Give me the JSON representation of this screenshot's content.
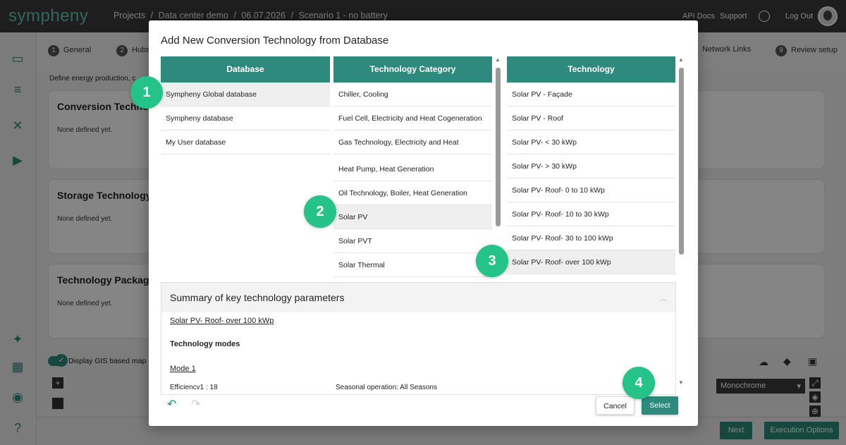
{
  "app": {
    "logo": "sympheny"
  },
  "breadcrumb": [
    "Projects",
    "/",
    "Data center demo",
    "/",
    "06.07.2026",
    "/",
    "Scenario 1 - no battery"
  ],
  "topnav": {
    "api_docs": "API Docs",
    "support": "Support",
    "logout": "Log Out"
  },
  "steps": [
    {
      "num": "1",
      "label": "General"
    },
    {
      "num": "2",
      "label": "Hubs"
    },
    {
      "num": "",
      "label": "Network Links"
    },
    {
      "num": "9",
      "label": "Review setup"
    }
  ],
  "page": {
    "subtitle": "Define energy production, c",
    "cards": [
      {
        "title": "Conversion Technolo",
        "empty": "None defined yet."
      },
      {
        "title": "Storage Technology",
        "empty": "None defined yet."
      },
      {
        "title": "Technology Package",
        "empty": "None defined yet."
      }
    ],
    "gis_toggle_label": "Display GIS based map",
    "map_style": "Monochrome",
    "next_button": "Next",
    "execution_button": "Execution Options"
  },
  "modal": {
    "title": "Add New Conversion Technology from Database",
    "database": {
      "header": "Database",
      "items": [
        "Sympheny Global database",
        "Sympheny database",
        "My User database"
      ]
    },
    "category": {
      "header": "Technology Category",
      "items": [
        "Chiller, Cooling",
        "Fuel Cell, Electricity and Heat Cogeneration",
        "Gas Technology, Electricity and Heat",
        "Heat Pump, Heat Generation",
        "Oil Technology, Boiler, Heat Generation",
        "Solar PV",
        "Solar PVT",
        "Solar Thermal"
      ]
    },
    "technology": {
      "header": "Technology",
      "items": [
        "Solar PV - Façade",
        "Solar PV - Roof",
        "Solar PV- < 30 kWp",
        "Solar PV- > 30 kWp",
        "Solar PV- Roof- 0 to 10 kWp",
        "Solar PV- Roof- 10 to 30 kWp",
        "Solar PV- Roof- 30 to 100 kWp",
        "Solar PV- Roof- over 100 kWp"
      ]
    },
    "summary": {
      "header": "Summary of key technology parameters",
      "technology": "Solar PV- Roof- over 100 kWp",
      "modes_label": "Technology modes",
      "mode_name": "Mode 1",
      "efficiency": "Efficiencv1 : 18",
      "seasonal": "Seasonal operation: All Seasons"
    },
    "cancel": "Cancel",
    "select": "Select"
  },
  "markers": [
    "1",
    "2",
    "3",
    "4"
  ],
  "colors": {
    "accent": "#2d8a7c",
    "marker": "#25c28a",
    "topbar": "#3a3a3a"
  }
}
